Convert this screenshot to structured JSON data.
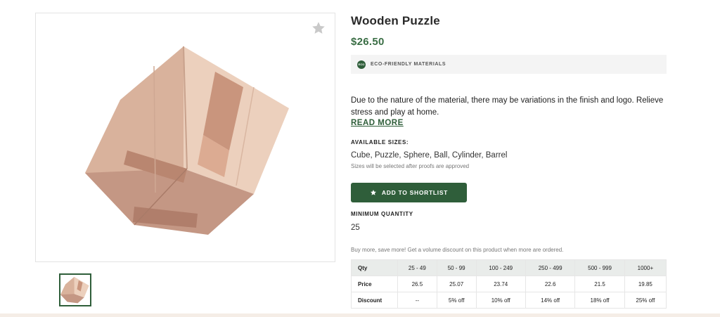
{
  "product": {
    "title": "Wooden Puzzle",
    "price": "$26.50",
    "eco_badge": {
      "icon": "eco-leaf-icon",
      "icon_text": "ECO",
      "label": "ECO-FRIENDLY MATERIALS"
    },
    "description": "Due to the nature of the material, there may be variations in the finish and logo. Relieve stress and play at home.",
    "read_more": "READ MORE",
    "sizes": {
      "heading": "AVAILABLE SIZES:",
      "value": "Cube, Puzzle, Sphere, Ball, Cylinder, Barrel",
      "note": "Sizes will be selected after proofs are approved"
    },
    "shortlist_button": {
      "icon": "star-icon",
      "label": "ADD TO SHORTLIST"
    },
    "minimum_quantity": {
      "heading": "MINIMUM QUANTITY",
      "value": "25"
    },
    "volume_note": "Buy more, save more! Get a volume discount on this product when more are ordered.",
    "price_table": {
      "headers": [
        "Qty",
        "25 - 49",
        "50 - 99",
        "100 - 249",
        "250 - 499",
        "500 - 999",
        "1000+"
      ],
      "rows": [
        [
          "Price",
          "26.5",
          "25.07",
          "23.74",
          "22.6",
          "21.5",
          "19.85"
        ],
        [
          "Discount",
          "--",
          "5% off",
          "10% off",
          "14% off",
          "18% off",
          "25% off"
        ]
      ]
    }
  },
  "gallery": {
    "favorite_icon": "star-icon",
    "image": "wooden-puzzle-cube",
    "thumbnails": [
      "wooden-puzzle-cube"
    ]
  },
  "colors": {
    "brand_green": "#2f5e3a",
    "price_green": "#3a6e45",
    "wood": "#e3c4ad"
  }
}
